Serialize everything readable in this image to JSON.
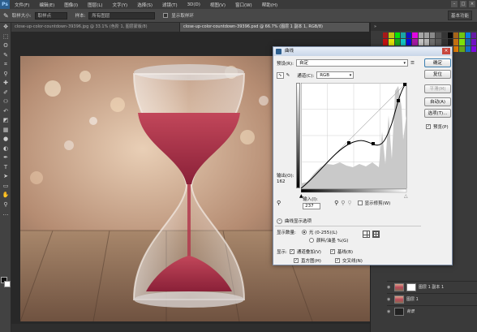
{
  "menubar": {
    "logo": "Ps",
    "items": [
      "文件(F)",
      "编辑(E)",
      "图像(I)",
      "图层(L)",
      "文字(Y)",
      "选择(S)",
      "滤镜(T)",
      "3D(D)",
      "视图(V)",
      "窗口(W)",
      "帮助(H)"
    ]
  },
  "options": {
    "tool_icon": "✎",
    "size_label": "取样大小:",
    "size_value": "取样点",
    "sample_label": "样本:",
    "sample_value": "所有图层",
    "show_ring": "显示取样环",
    "workspace": "基本功能"
  },
  "tabs": [
    "close-up-color-countdown-39396.jpg @ 33.1% (色阶 1, 图层蒙版/8)",
    "close-up-color-countdown-39396.psd @ 66.7% (图层 1 副本 1, RGB/8)"
  ],
  "dialog": {
    "title": "曲线",
    "preset_label": "预设(R):",
    "preset_value": "自定",
    "channel_label": "通道(C):",
    "channel_value": "RGB",
    "output_label": "输出(O):",
    "output_value": "162",
    "input_label": "输入(I):",
    "input_value": "237",
    "show_clipping": "显示修剪(W)",
    "curve_options": "曲线显示选项",
    "amount_label": "显示数量:",
    "light_option": "光 (0-255)(L)",
    "pigment_option": "颜料/油墨 %(G)",
    "show_label": "显示:",
    "channel_overlays": "通道叠加(V)",
    "baseline": "基线(B)",
    "histogram": "直方图(H)",
    "intersection": "交叉线(N)",
    "buttons": {
      "ok": "确定",
      "cancel": "复位",
      "smooth": "平滑(M)",
      "auto": "自动(A)",
      "options": "选项(T)..."
    },
    "preview": "预览(P)"
  },
  "layers": [
    {
      "name": "图层 1 副本 1"
    },
    {
      "name": "图层 1"
    },
    {
      "name": "背景"
    }
  ],
  "colors": {
    "accent": "#3c7fb1",
    "sand": "#b9475a",
    "panel": "#3a3a3a"
  }
}
